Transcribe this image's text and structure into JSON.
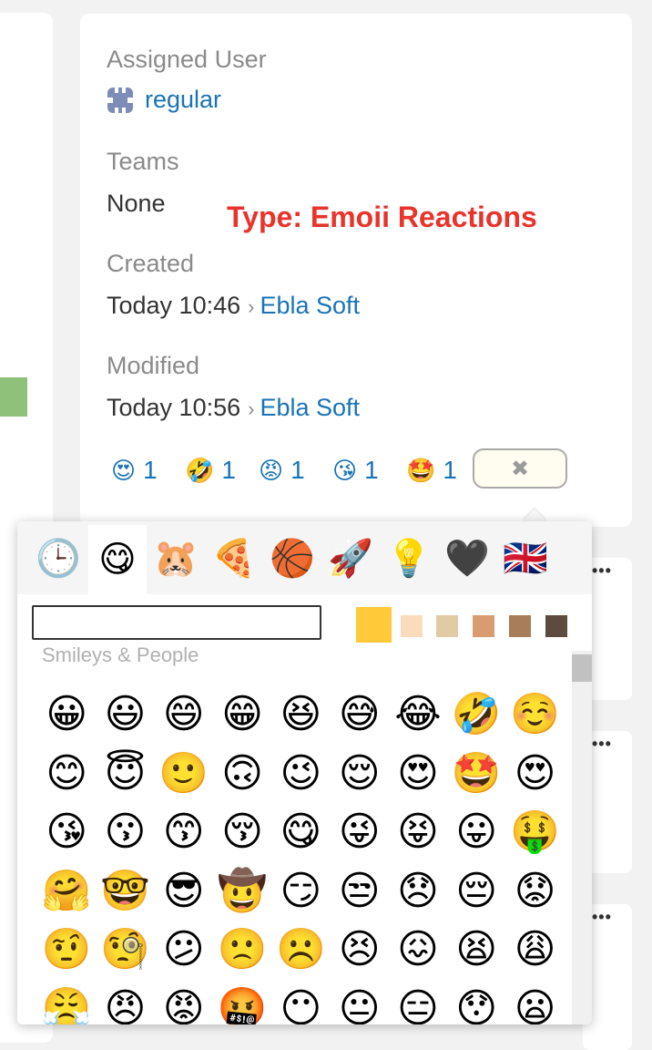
{
  "details": {
    "assigned_user_label": "Assigned User",
    "assigned_user_value": "regular",
    "teams_label": "Teams",
    "teams_value": "None",
    "created_label": "Created",
    "created_time": "Today 10:46",
    "created_by": "Ebla Soft",
    "modified_label": "Modified",
    "modified_time": "Today 10:56",
    "modified_by": "Ebla Soft"
  },
  "annotation": "Type: Emoii Reactions",
  "reactions": [
    {
      "emoji": "😍",
      "count": "1"
    },
    {
      "emoji": "🤣",
      "count": "1"
    },
    {
      "emoji": "😡",
      "count": "1"
    },
    {
      "emoji": "😘",
      "count": "1"
    },
    {
      "emoji": "🤩",
      "count": "1"
    }
  ],
  "reaction_close_symbol": "✖",
  "picker": {
    "categories": [
      {
        "name": "recent-icon",
        "glyph": "🕒"
      },
      {
        "name": "smileys-icon",
        "glyph": "😋"
      },
      {
        "name": "animals-icon",
        "glyph": "🐹"
      },
      {
        "name": "food-icon",
        "glyph": "🍕"
      },
      {
        "name": "activity-icon",
        "glyph": "🏀"
      },
      {
        "name": "travel-icon",
        "glyph": "🚀"
      },
      {
        "name": "objects-icon",
        "glyph": "💡"
      },
      {
        "name": "symbols-icon",
        "glyph": "🖤"
      },
      {
        "name": "flags-icon",
        "glyph": "🇬🇧"
      }
    ],
    "search_value": "",
    "skin_tones": [
      "#ffc93a",
      "#fadcbc",
      "#e0cba5",
      "#d99b70",
      "#a87e5a",
      "#5e4b3f"
    ],
    "section_title": "Smileys & People",
    "emojis": [
      "😀",
      "😃",
      "😄",
      "😁",
      "😆",
      "😅",
      "😂",
      "🤣",
      "☺️",
      "😊",
      "😇",
      "🙂",
      "🙃",
      "😉",
      "😌",
      "😍",
      "🤩",
      "😍",
      "😘",
      "😗",
      "😙",
      "😚",
      "😋",
      "😜",
      "😝",
      "😛",
      "🤑",
      "🤗",
      "🤓",
      "😎",
      "🤠",
      "😏",
      "😒",
      "😞",
      "😔",
      "😟",
      "🤨",
      "🧐",
      "😕",
      "🙁",
      "☹️",
      "😣",
      "😖",
      "😫",
      "😩",
      "😤",
      "😠",
      "😡",
      "🤬",
      "😶",
      "😐",
      "😑",
      "😯",
      "😦"
    ]
  },
  "side_cards": {
    "dots": "•••"
  }
}
